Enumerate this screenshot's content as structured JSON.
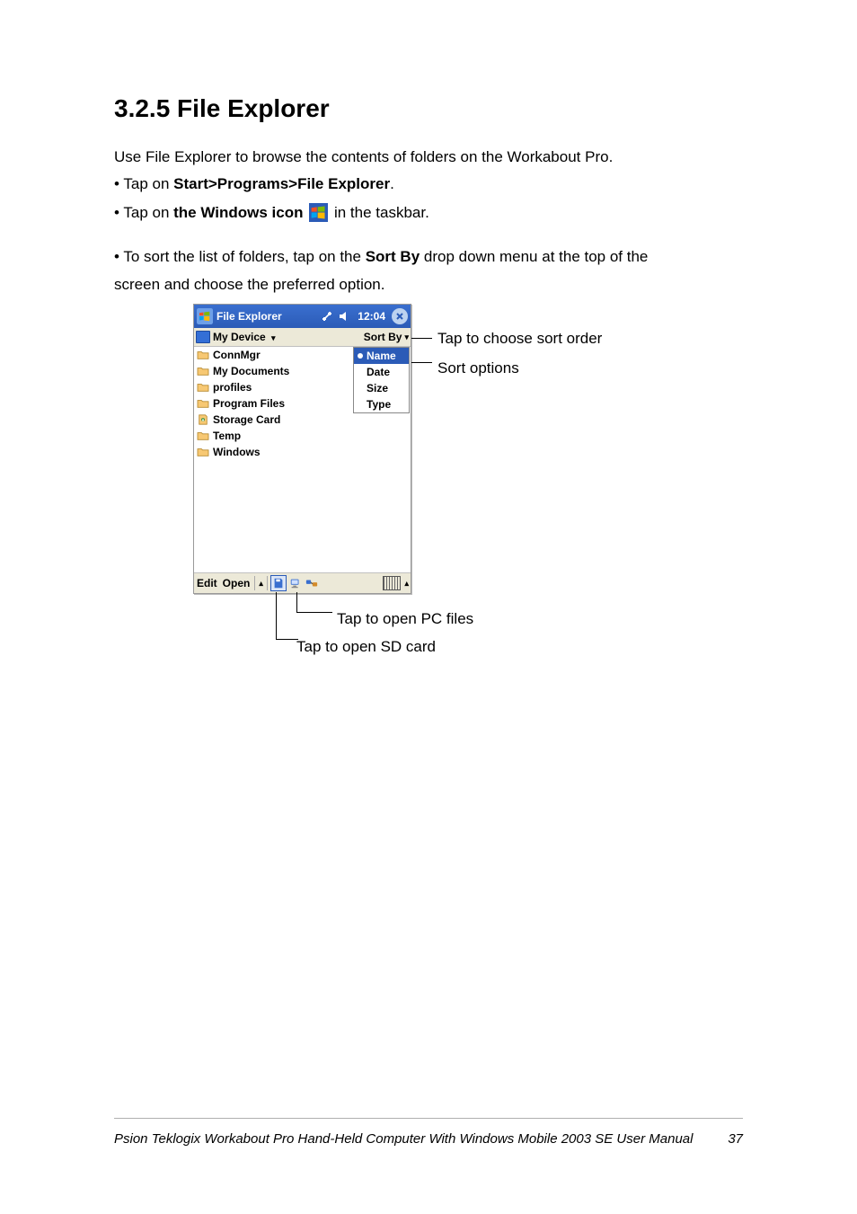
{
  "section_title": "3.2.5 File Explorer",
  "body": {
    "line1": "Use File Explorer to browse the contents of folders on the Workabout Pro.",
    "line2_prefix": "• Tap on ",
    "line2_strong": "Start>Programs>File Explorer",
    "line2_suffix": ".",
    "line3_prefix": "• Tap on ",
    "line3_strong": "the Windows icon ",
    "line3_suffix": " in the taskbar.",
    "sort1_prefix": "• To sort the list of folders, tap on the ",
    "sort1_strong": "Sort By",
    "sort1_suffix": " drop down menu at the top of the",
    "sort2": "screen and choose the preferred option."
  },
  "screenshot": {
    "title": "File Explorer",
    "time": "12:04",
    "location": "My Device",
    "sort_label": "Sort By",
    "sort_options": [
      "Name",
      "Date",
      "Size",
      "Type"
    ],
    "sort_active": "Name",
    "rows": [
      {
        "name": "ConnMgr",
        "icon": "folder"
      },
      {
        "name": "My Documents",
        "icon": "folder"
      },
      {
        "name": "profiles",
        "icon": "folder"
      },
      {
        "name": "Program Files",
        "icon": "folder"
      },
      {
        "name": "Storage Card",
        "icon": "sdcard"
      },
      {
        "name": "Temp",
        "icon": "folder"
      },
      {
        "name": "Windows",
        "icon": "folder"
      }
    ],
    "menus": {
      "edit": "Edit",
      "open": "Open"
    }
  },
  "callouts": {
    "tap_to_choose_sort": "Tap to choose sort order",
    "sort_options": "Sort options",
    "open_pc_files": "Tap to open PC files",
    "open_sdcard": "Tap to open SD card"
  },
  "footer_left": "Psion Teklogix Workabout Pro Hand-Held Computer With Windows Mobile 2003 SE User Manual",
  "footer_right": "37"
}
